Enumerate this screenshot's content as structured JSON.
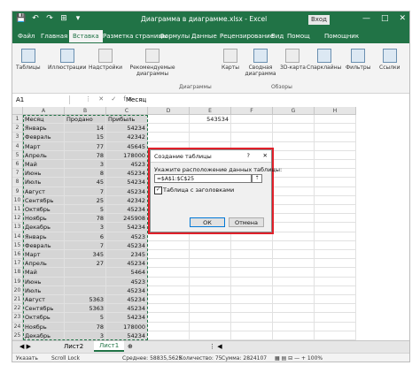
{
  "window": {
    "title": "Диаграмма в диаграмме.xlsx  -  Excel",
    "signin": "Вход",
    "controls": [
      "—",
      "□",
      "✕"
    ]
  },
  "qat": [
    "💾",
    "↶",
    "↷",
    "⊞",
    "▾"
  ],
  "tabs": [
    "Файл",
    "Главная",
    "Вставка",
    "Разметка страницы",
    "Формулы",
    "Данные",
    "Рецензирование",
    "Вид",
    "Помощ",
    "Помощник"
  ],
  "ribbon": {
    "items": [
      "Таблицы",
      "Иллюстрации",
      "Надстройки",
      "Рекомендуемые диаграммы",
      "Карты",
      "Сводная диаграмма",
      "3D-карта",
      "Спарклайны",
      "Фильтры",
      "Ссылки"
    ],
    "groups": [
      "Диаграммы",
      "Обзоры"
    ]
  },
  "formula_bar": {
    "name_box": "A1",
    "icons": "⋮ ✕ ✓ fx",
    "value": "Месяц"
  },
  "columns": [
    "A",
    "B",
    "C",
    "D",
    "E",
    "F",
    "G",
    "H"
  ],
  "rows": [
    {
      "n": "1",
      "a": "Месяц",
      "b": "Продано",
      "c": "Прибыль",
      "e": "543534"
    },
    {
      "n": "2",
      "a": "Январь",
      "b": "14",
      "c": "54234"
    },
    {
      "n": "3",
      "a": "Февраль",
      "b": "15",
      "c": "42342"
    },
    {
      "n": "4",
      "a": "Март",
      "b": "77",
      "c": "45645"
    },
    {
      "n": "5",
      "a": "Апрель",
      "b": "78",
      "c": "178000"
    },
    {
      "n": "6",
      "a": "Май",
      "b": "3",
      "c": "4523"
    },
    {
      "n": "7",
      "a": "Июнь",
      "b": "8",
      "c": "45234"
    },
    {
      "n": "8",
      "a": "Июль",
      "b": "45",
      "c": "54234"
    },
    {
      "n": "9",
      "a": "Август",
      "b": "7",
      "c": "45234"
    },
    {
      "n": "10",
      "a": "Сентябрь",
      "b": "25",
      "c": "42342"
    },
    {
      "n": "11",
      "a": "Октябрь",
      "b": "5",
      "c": "45234"
    },
    {
      "n": "12",
      "a": "Ноябрь",
      "b": "78",
      "c": "245908"
    },
    {
      "n": "13",
      "a": "Декабрь",
      "b": "3",
      "c": "54234"
    },
    {
      "n": "14",
      "a": "Январь",
      "b": "6",
      "c": "4523"
    },
    {
      "n": "15",
      "a": "Февраль",
      "b": "7",
      "c": "45234"
    },
    {
      "n": "16",
      "a": "Март",
      "b": "345",
      "c": "2345"
    },
    {
      "n": "17",
      "a": "Апрель",
      "b": "27",
      "c": "45234"
    },
    {
      "n": "18",
      "a": "Май",
      "b": "",
      "c": "5464"
    },
    {
      "n": "19",
      "a": "Июнь",
      "b": "",
      "c": "4523"
    },
    {
      "n": "20",
      "a": "Июль",
      "b": "",
      "c": "45234"
    },
    {
      "n": "21",
      "a": "Август",
      "b": "5363",
      "c": "45234"
    },
    {
      "n": "22",
      "a": "Сентябрь",
      "b": "5363",
      "c": "45234"
    },
    {
      "n": "23",
      "a": "Октябрь",
      "b": "5",
      "c": "54234"
    },
    {
      "n": "24",
      "a": "Ноябрь",
      "b": "78",
      "c": "178000"
    },
    {
      "n": "25",
      "a": "Декабрь",
      "b": "3",
      "c": "54234"
    }
  ],
  "dialog": {
    "title": "Создание таблицы",
    "help": "?",
    "close": "✕",
    "prompt": "Укажите расположение данных таблицы:",
    "range": "=$A$1:$C$25",
    "range_btn": "⇡",
    "checkbox_checked": "✓",
    "checkbox_label": "Таблица с заголовками",
    "ok": "ОК",
    "cancel": "Отмена"
  },
  "sheet_tabs": {
    "nav": "◀ ▶",
    "tabs": [
      "Лист2",
      "Лист1"
    ],
    "add": "⊕",
    "more": "⋮ ◀"
  },
  "status": {
    "mode": "Указать",
    "scroll": "Scroll Lock",
    "average": "Среднее: 58835,5625",
    "count": "Количество: 75",
    "sum": "Сумма: 2824107",
    "zoom_ctl": "▦ ▤ ⊟ — + 100%"
  },
  "colors": {
    "accent": "#217346",
    "dialog_highlight": "#e0202a"
  }
}
